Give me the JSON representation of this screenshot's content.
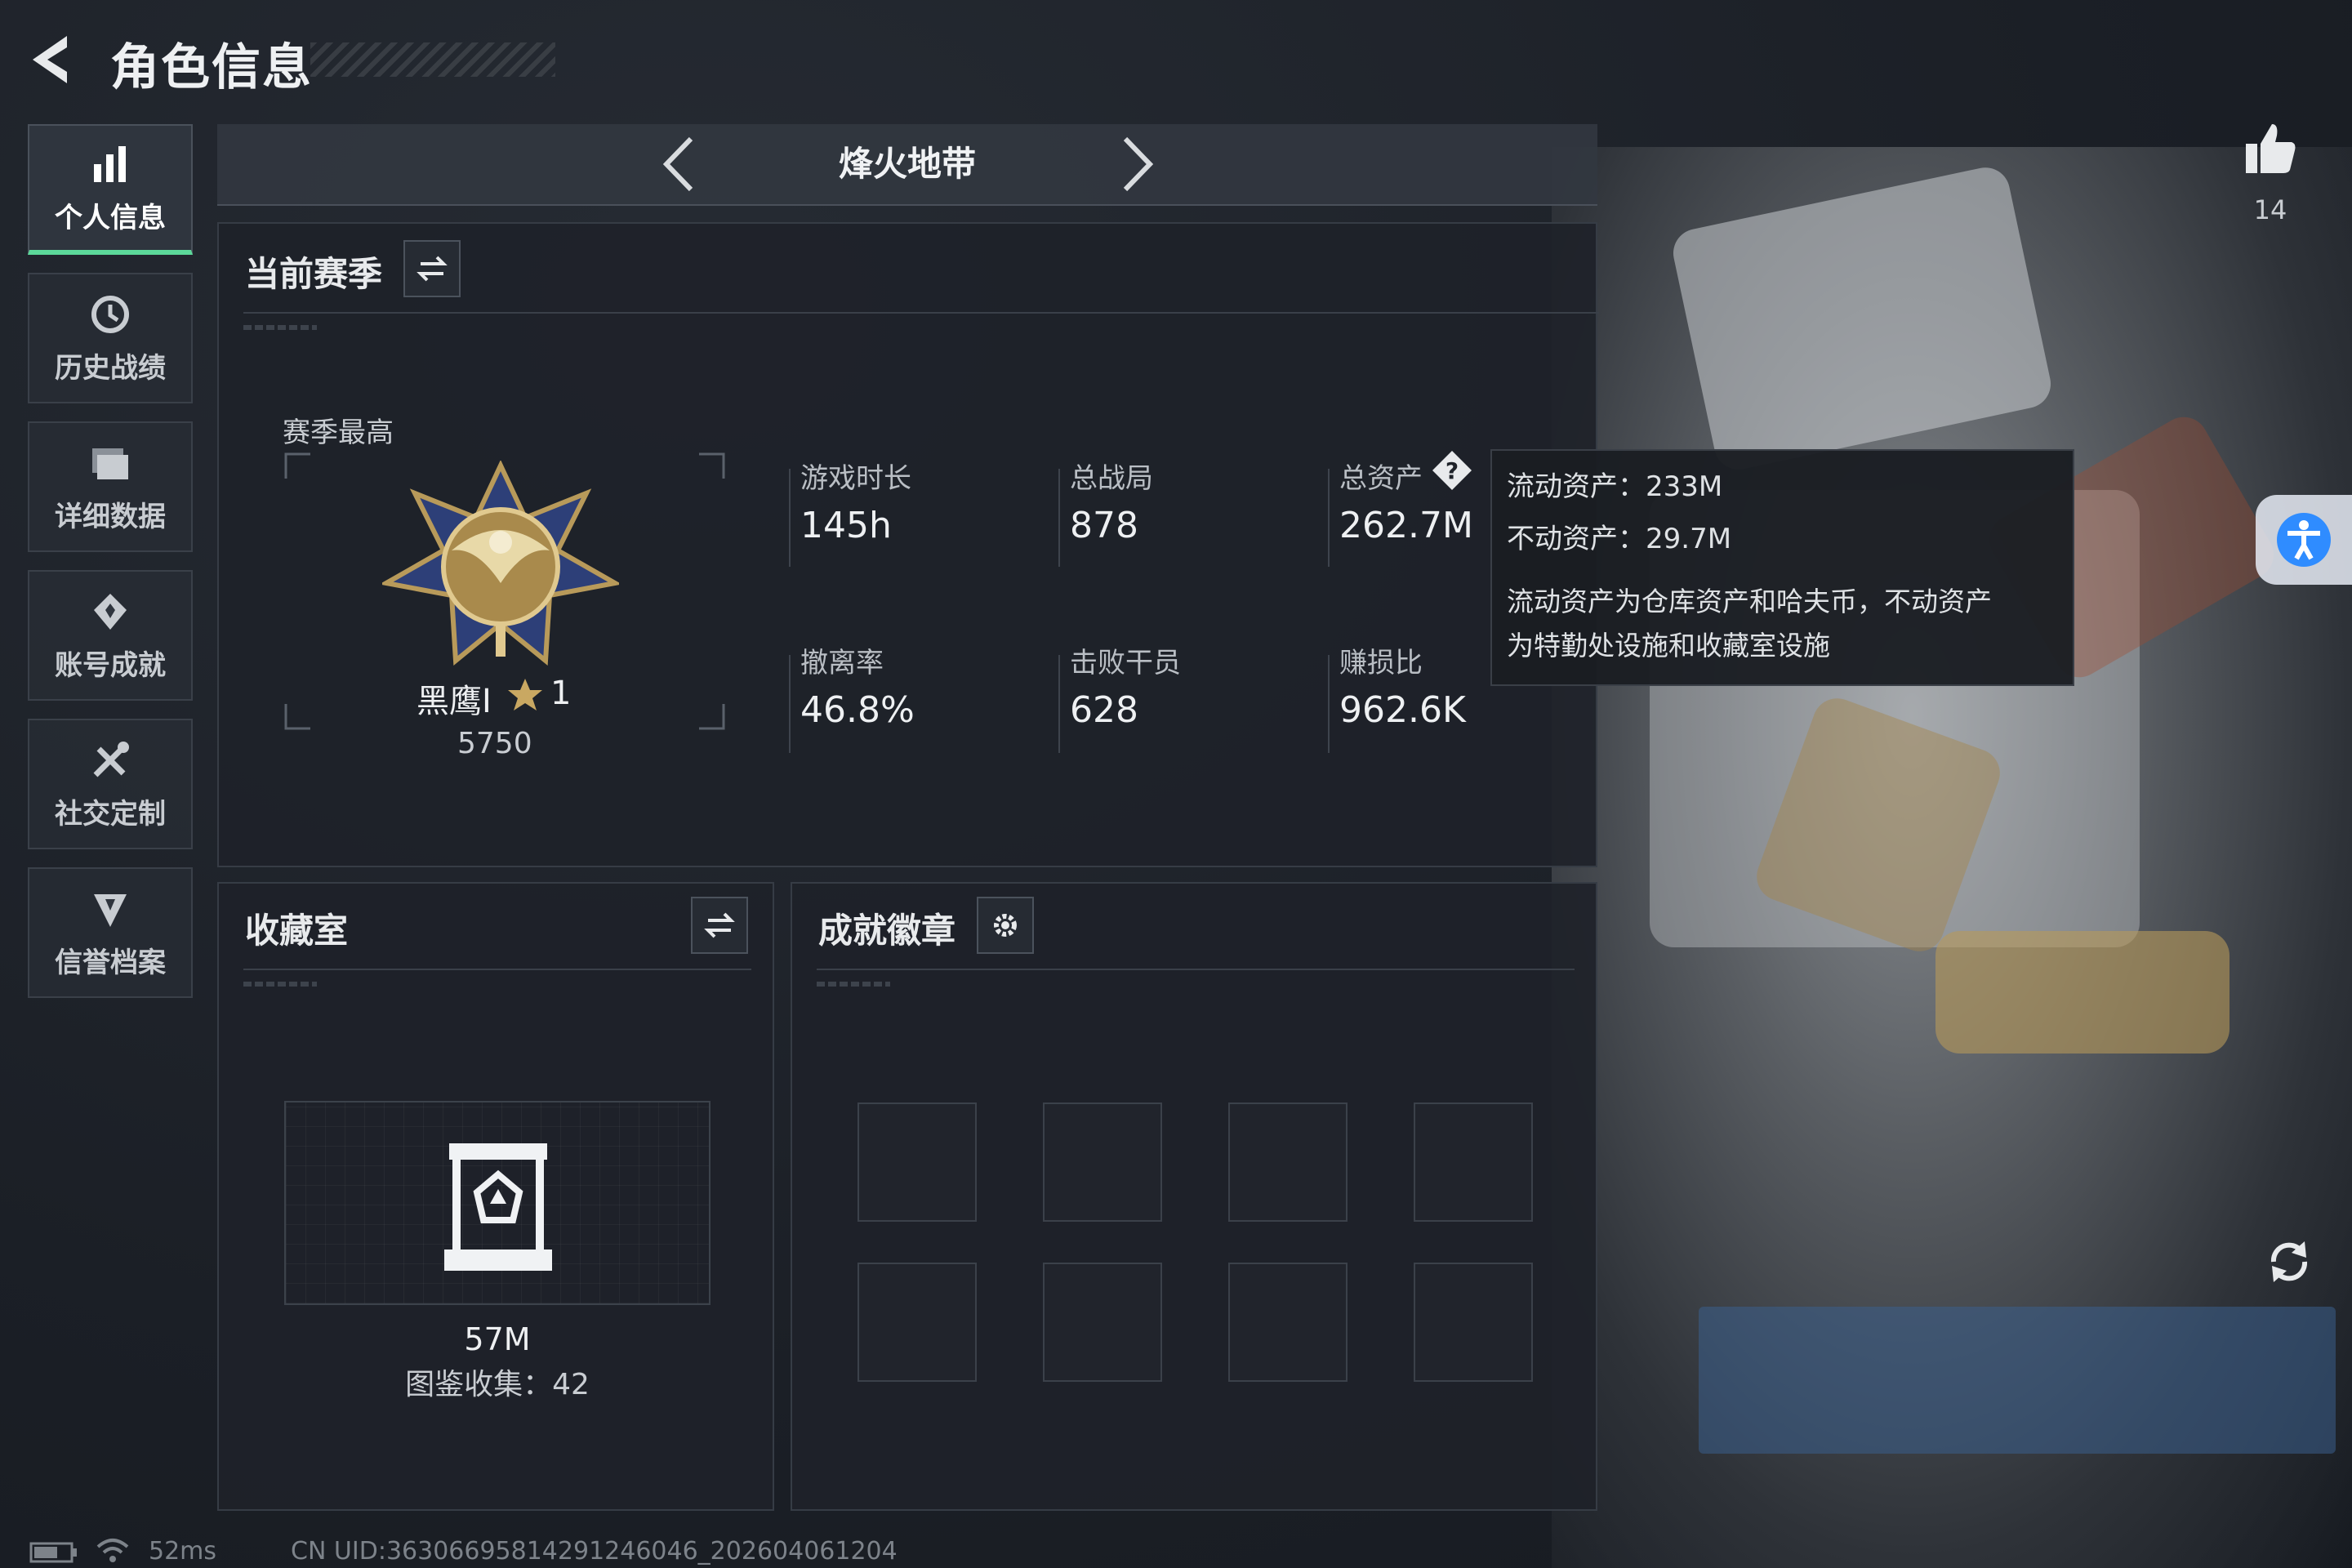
{
  "header": {
    "title": "角色信息"
  },
  "sidebar": {
    "items": [
      {
        "label": "个人信息",
        "icon": "bar-chart-icon",
        "active": true
      },
      {
        "label": "历史战绩",
        "icon": "clock-history-icon",
        "active": false
      },
      {
        "label": "详细数据",
        "icon": "folder-icon",
        "active": false
      },
      {
        "label": "账号成就",
        "icon": "medal-icon",
        "active": false
      },
      {
        "label": "社交定制",
        "icon": "tools-icon",
        "active": false
      },
      {
        "label": "信誉档案",
        "icon": "shield-icon",
        "active": false
      }
    ]
  },
  "mode_bar": {
    "title": "烽火地带"
  },
  "season": {
    "title": "当前赛季",
    "best_label": "赛季最高",
    "rank_name": "黑鹰I",
    "rank_stars": "1",
    "rank_points": "5750",
    "stats": [
      {
        "label": "游戏时长",
        "value": "145h"
      },
      {
        "label": "总战局",
        "value": "878"
      },
      {
        "label": "总资产",
        "value": "262.7M"
      },
      {
        "label": "撤离率",
        "value": "46.8%"
      },
      {
        "label": "击败干员",
        "value": "628"
      },
      {
        "label": "赚损比",
        "value": "962.6K"
      }
    ]
  },
  "tooltip": {
    "liquid": "流动资产：233M",
    "fixed": "不动资产：29.7M",
    "desc_line1": "流动资产为仓库资产和哈夫币，不动资产",
    "desc_line2": "为特勤处设施和收藏室设施"
  },
  "collection": {
    "title": "收藏室",
    "value": "57M",
    "count_text": "图鉴收集：42"
  },
  "badges": {
    "title": "成就徽章",
    "slots": 8
  },
  "likes": {
    "count": "14"
  },
  "status": {
    "ping": "52ms",
    "uid": "CN UID:3630669581429124604​6_202604061204"
  },
  "colors": {
    "accent_green": "#5cd89a",
    "accessibility_blue": "#2f8cff",
    "panel_bg": "#1e2229"
  }
}
